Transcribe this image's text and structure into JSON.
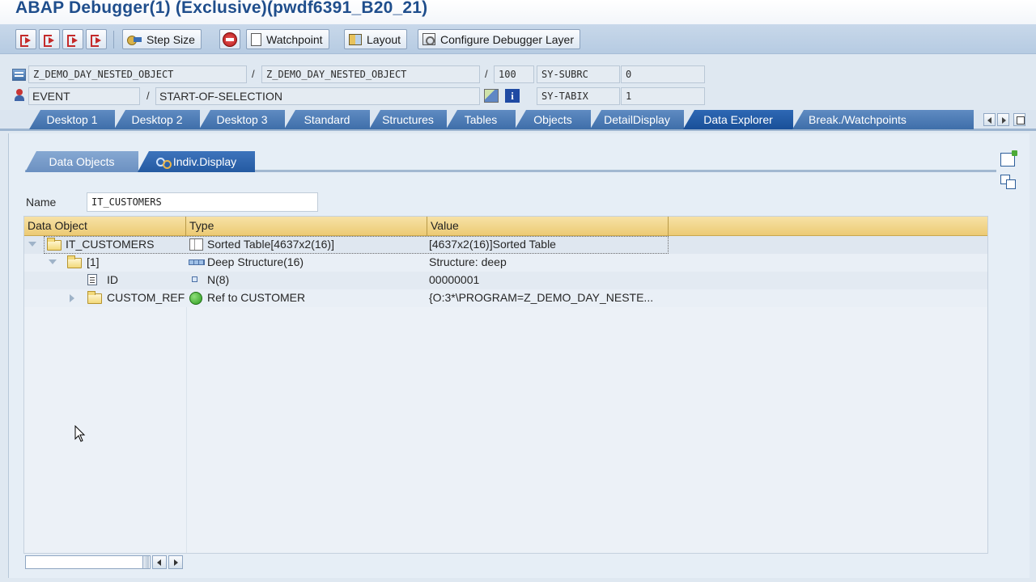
{
  "window": {
    "title": "ABAP Debugger(1)  (Exclusive)(pwdf6391_B20_21)"
  },
  "toolbar": {
    "step_size_label": "Step Size",
    "watchpoint_label": "Watchpoint",
    "layout_label": "Layout",
    "configure_label": "Configure Debugger Layer"
  },
  "info": {
    "program": "Z_DEMO_DAY_NESTED_OBJECT",
    "include": "Z_DEMO_DAY_NESTED_OBJECT",
    "line": "100",
    "sy_subrc_label": "SY-SUBRC",
    "sy_subrc_value": "0",
    "event_type": "EVENT",
    "event_name": "START-OF-SELECTION",
    "sy_tabix_label": "SY-TABIX",
    "sy_tabix_value": "1",
    "separator": "/"
  },
  "tabs": [
    {
      "label": "Desktop 1"
    },
    {
      "label": "Desktop 2"
    },
    {
      "label": "Desktop 3"
    },
    {
      "label": "Standard"
    },
    {
      "label": "Structures"
    },
    {
      "label": "Tables"
    },
    {
      "label": "Objects"
    },
    {
      "label": "DetailDisplay"
    },
    {
      "label": "Data Explorer",
      "active": true
    },
    {
      "label": "Break./Watchpoints"
    }
  ],
  "subtabs": [
    {
      "label": "Data Objects"
    },
    {
      "label": "Indiv.Display",
      "active": true
    }
  ],
  "name_field": {
    "label": "Name",
    "value": "IT_CUSTOMERS"
  },
  "grid": {
    "headers": [
      "Data Object",
      "Type",
      "Value"
    ],
    "rows": [
      {
        "object": "IT_CUSTOMERS",
        "type": "Sorted Table[4637x2(16)]",
        "value": "[4637x2(16)]Sorted Table",
        "expanded": true,
        "level": 0
      },
      {
        "object": "[1]",
        "type": "Deep Structure(16)",
        "value": "Structure: deep",
        "expanded": true,
        "level": 1
      },
      {
        "object": "ID",
        "type": "N(8)",
        "value": "00000001",
        "level": 2
      },
      {
        "object": "CUSTOM_REF",
        "type": "Ref to CUSTOMER",
        "value": "{O:3*\\PROGRAM=Z_DEMO_DAY_NESTE...",
        "expanded": false,
        "level": 1
      }
    ]
  },
  "icons": {
    "toolbar": [
      "single-step-icon",
      "execute-icon",
      "return-icon",
      "continue-icon",
      "stop-icon",
      "watchpoint-icon",
      "layout-icon",
      "configure-icon"
    ],
    "colors": {
      "tab": "#3e6ea9",
      "tab_active": "#194f98",
      "grid_header": "#ecca74",
      "title": "#1f4e8c"
    }
  }
}
